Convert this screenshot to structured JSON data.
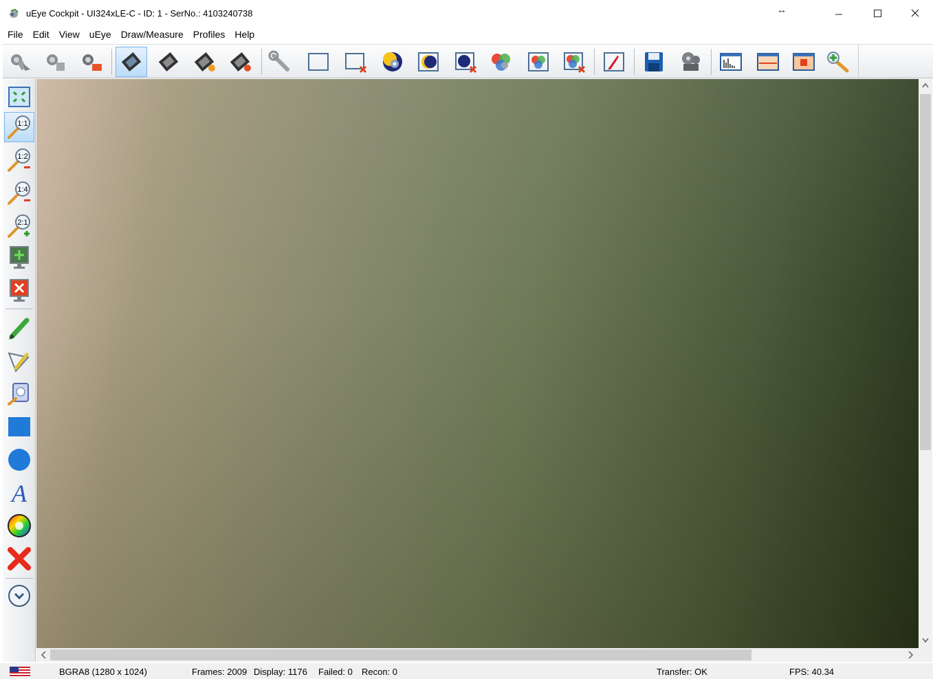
{
  "window": {
    "title": "uEye Cockpit - UI324xLE-C - ID: 1 - SerNo.: 4103240738",
    "resize_hint": "↔",
    "controls": [
      "minimize",
      "maximize",
      "close"
    ]
  },
  "menu": [
    "File",
    "Edit",
    "View",
    "uEye",
    "Draw/Measure",
    "Profiles",
    "Help"
  ],
  "toolbar": {
    "buttons": [
      {
        "name": "open-camera",
        "icon": "camera-open-icon"
      },
      {
        "name": "open-camera-all",
        "icon": "camera-open-all-icon"
      },
      {
        "name": "close-camera",
        "icon": "camera-close-icon"
      },
      {
        "name": "live-video",
        "icon": "film-live-icon",
        "active": true
      },
      {
        "name": "snapshot",
        "icon": "film-snapshot-icon"
      },
      {
        "name": "record-start",
        "icon": "film-record-icon"
      },
      {
        "name": "record-stop",
        "icon": "film-stop-icon"
      },
      {
        "name": "camera-properties",
        "icon": "wrench-icon"
      },
      {
        "name": "aoi",
        "icon": "aoi-rectangle-icon"
      },
      {
        "name": "aoi-reset",
        "icon": "aoi-reset-icon"
      },
      {
        "name": "auto-exposure",
        "icon": "auto-exposure-icon"
      },
      {
        "name": "exposure-moon",
        "icon": "exposure-moon-icon"
      },
      {
        "name": "exposure-reset",
        "icon": "exposure-reset-icon"
      },
      {
        "name": "color-settings",
        "icon": "color-gear-icon"
      },
      {
        "name": "white-balance",
        "icon": "white-balance-icon"
      },
      {
        "name": "white-balance-reset",
        "icon": "white-balance-reset-icon"
      },
      {
        "name": "hotpixel",
        "icon": "hotpixel-icon"
      },
      {
        "name": "save-image",
        "icon": "floppy-save-icon"
      },
      {
        "name": "video-reel",
        "icon": "film-reel-icon"
      },
      {
        "name": "histogram",
        "icon": "histogram-icon"
      },
      {
        "name": "line-view",
        "icon": "line-view-icon"
      },
      {
        "name": "aoi-view",
        "icon": "aoi-view-icon"
      },
      {
        "name": "zoom-tool",
        "icon": "zoom-plus-icon"
      }
    ]
  },
  "left_toolbar": {
    "buttons": [
      {
        "name": "fit-window",
        "icon": "fit-window-icon"
      },
      {
        "name": "zoom-1-1",
        "icon": "zoom-1-1-icon",
        "label": "1:1",
        "active": true
      },
      {
        "name": "zoom-1-2",
        "icon": "zoom-1-2-icon",
        "label": "1:2"
      },
      {
        "name": "zoom-1-4",
        "icon": "zoom-1-4-icon",
        "label": "1:4"
      },
      {
        "name": "zoom-2-1",
        "icon": "zoom-2-1-icon",
        "label": "2:1"
      },
      {
        "name": "fullscreen",
        "icon": "monitor-fullscreen-icon"
      },
      {
        "name": "fullscreen-close",
        "icon": "monitor-close-icon"
      },
      {
        "name": "draw-line",
        "icon": "pencil-icon"
      },
      {
        "name": "draw-polyline",
        "icon": "polyline-pencil-icon"
      },
      {
        "name": "draw-curve",
        "icon": "curve-icon"
      },
      {
        "name": "draw-rectangle",
        "icon": "rectangle-icon"
      },
      {
        "name": "draw-circle",
        "icon": "circle-icon"
      },
      {
        "name": "draw-text",
        "icon": "text-a-icon",
        "label": "A"
      },
      {
        "name": "draw-color",
        "icon": "color-wheel-icon"
      },
      {
        "name": "delete-drawing",
        "icon": "red-x-icon"
      },
      {
        "name": "more-tools",
        "icon": "chevron-circle-icon"
      }
    ]
  },
  "statusbar": {
    "format": "BGRA8 (1280 x 1024)",
    "frames": "Frames: 2009",
    "display": "Display: 1176",
    "failed": "Failed: 0",
    "recon": "Recon: 0",
    "transfer": "Transfer: OK",
    "fps": "FPS: 40.34"
  },
  "scroll": {
    "left_arrow": "<",
    "right_arrow": ">",
    "up_arrow": "^",
    "down_arrow": "v"
  }
}
